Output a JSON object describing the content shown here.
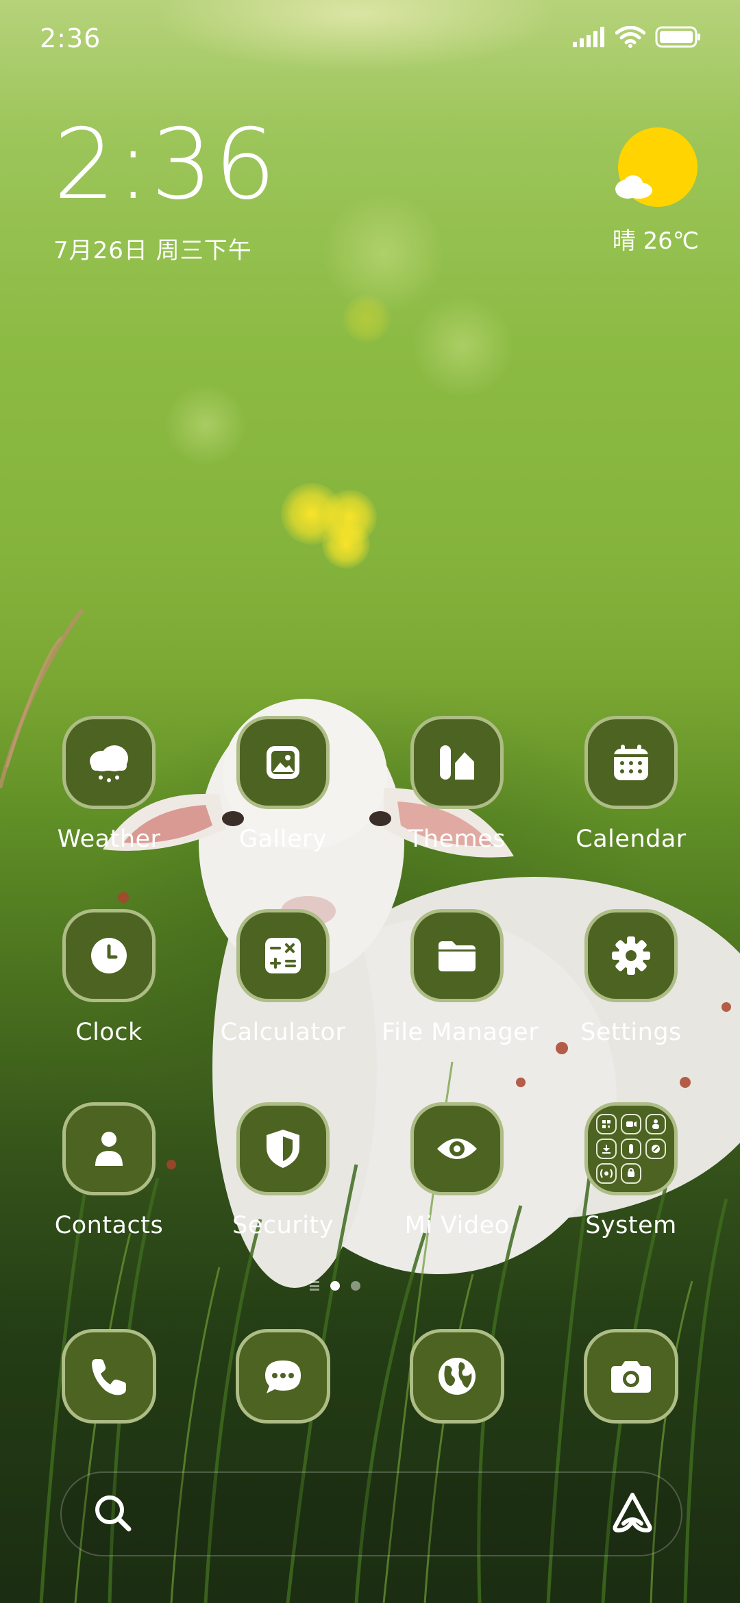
{
  "status_bar": {
    "time": "2:36"
  },
  "clock_widget": {
    "time": "2:36",
    "date": "7月26日 周三下午"
  },
  "weather_widget": {
    "condition_temp": "晴 26℃",
    "icon": "sun-cloud-icon"
  },
  "apps": [
    {
      "label": "Weather",
      "icon": "weather-cloud-icon"
    },
    {
      "label": "Gallery",
      "icon": "gallery-image-icon"
    },
    {
      "label": "Themes",
      "icon": "themes-brush-icon"
    },
    {
      "label": "Calendar",
      "icon": "calendar-icon"
    },
    {
      "label": "Clock",
      "icon": "clock-icon"
    },
    {
      "label": "Calculator",
      "icon": "calculator-icon"
    },
    {
      "label": "File Manager",
      "icon": "folder-icon"
    },
    {
      "label": "Settings",
      "icon": "gear-icon"
    },
    {
      "label": "Contacts",
      "icon": "person-icon"
    },
    {
      "label": "Security",
      "icon": "shield-icon"
    },
    {
      "label": "Mi Video",
      "icon": "eye-icon"
    },
    {
      "label": "System",
      "icon": "folder-grid-icon"
    }
  ],
  "dock": [
    {
      "icon": "phone-icon"
    },
    {
      "icon": "message-icon"
    },
    {
      "icon": "browser-globe-icon"
    },
    {
      "icon": "camera-icon"
    }
  ],
  "page_indicator": {
    "pages": 2,
    "current": 1
  },
  "search_bar": {
    "left_icon": "search-icon",
    "right_icon": "assistant-icon"
  },
  "colors": {
    "icon_fill": "#4d6322",
    "icon_border": "#bccd96",
    "sun": "#ffd400",
    "text": "#ffffff"
  }
}
